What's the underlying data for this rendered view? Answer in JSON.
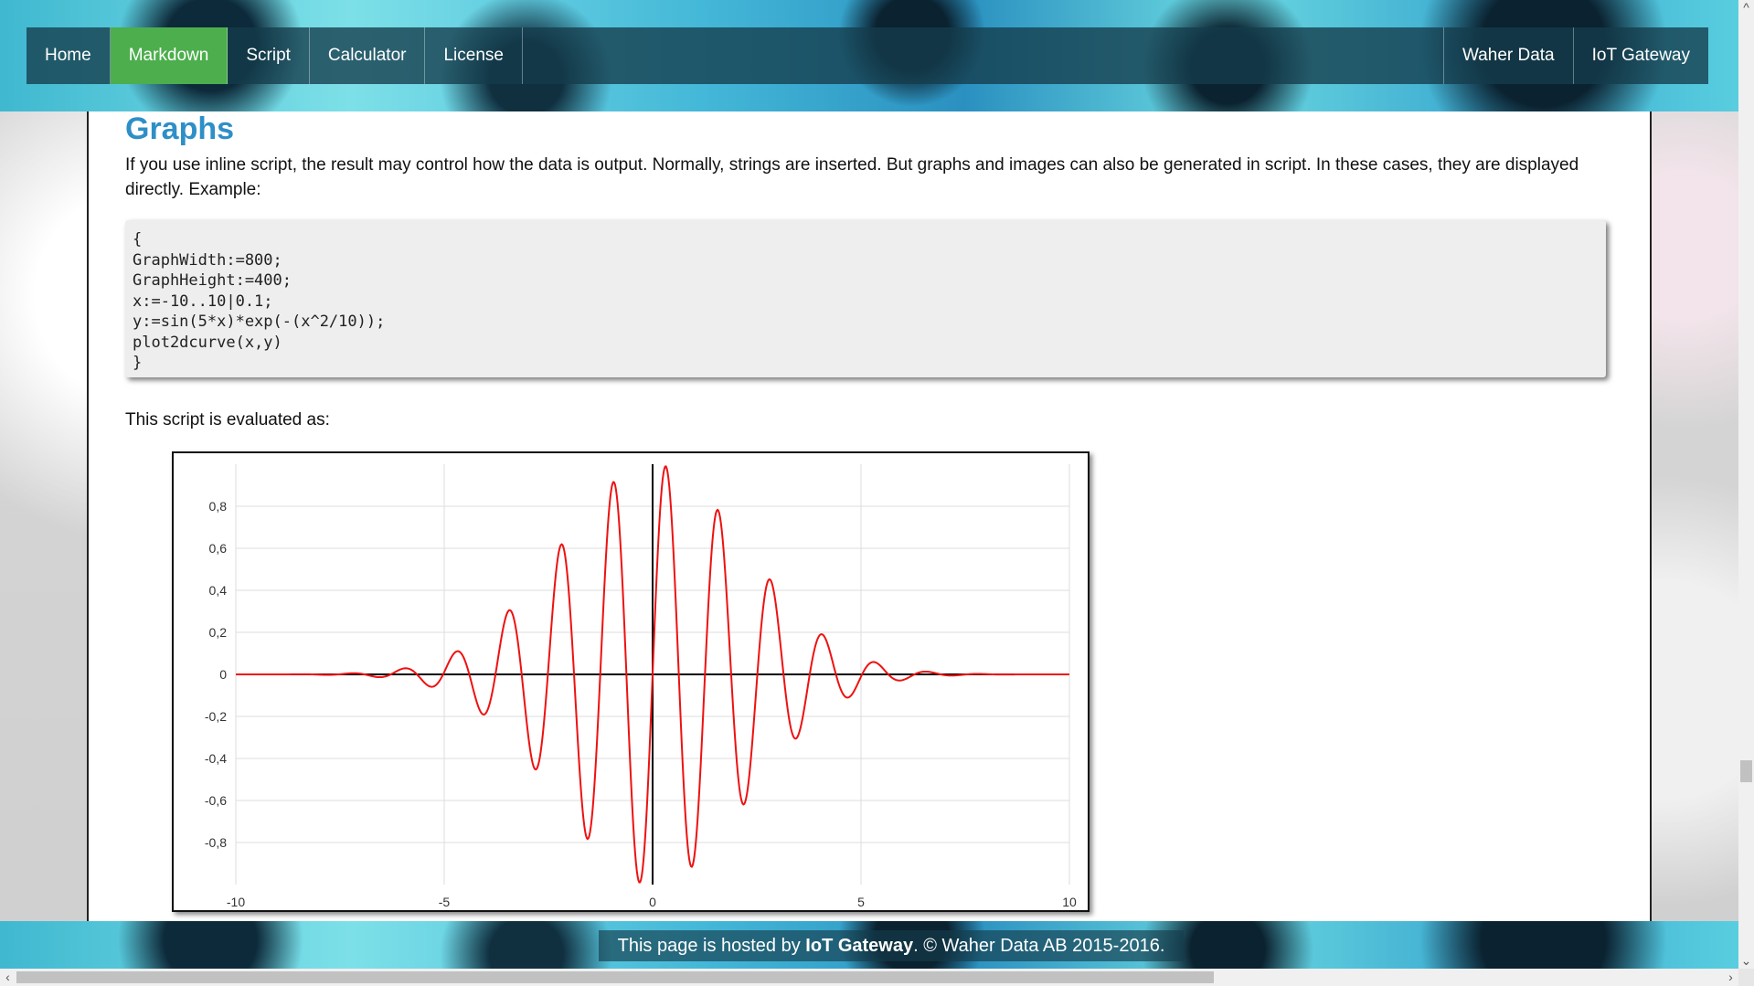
{
  "nav": {
    "left": [
      "Home",
      "Markdown",
      "Script",
      "Calculator",
      "License"
    ],
    "right": [
      "Waher Data",
      "IoT Gateway"
    ],
    "active": "Markdown"
  },
  "content": {
    "title": "Graphs",
    "intro": "If you use inline script, the result may control how the data is output. Normally, strings are inserted. But graphs and images can also be generated in script. In these cases, they are displayed directly. Example:",
    "code": "{\nGraphWidth:=800;\nGraphHeight:=400;\nx:=-10..10|0.1;\ny:=sin(5*x)*exp(-(x^2/10));\nplot2dcurve(x,y)\n}",
    "eval_text": "This script is evaluated as:"
  },
  "footer": {
    "prefix": "This page is hosted by ",
    "link1": "IoT Gateway",
    "middle": ". © ",
    "link2": "Waher Data AB",
    "suffix": " 2015-2016."
  },
  "chart_data": {
    "type": "line",
    "function": "sin(5*x)*exp(-(x^2/10))",
    "x_range": [
      -10,
      10
    ],
    "x_step": 0.1,
    "xlim": [
      -10,
      10
    ],
    "ylim": [
      -1,
      1
    ],
    "x_ticks": [
      "-10",
      "-5",
      "0",
      "5",
      "10"
    ],
    "y_ticks": [
      "0,8",
      "0,6",
      "0,4",
      "0,2",
      "0",
      "-0,2",
      "-0,4",
      "-0,6",
      "-0,8"
    ],
    "y_tick_values": [
      0.8,
      0.6,
      0.4,
      0.2,
      0,
      -0.2,
      -0.4,
      -0.6,
      -0.8
    ],
    "x_tick_values": [
      -10,
      -5,
      0,
      5,
      10
    ],
    "grid": true,
    "series": [
      {
        "color": "#ee1111"
      }
    ],
    "axis_color": "#000000"
  },
  "colors": {
    "active_nav": "#4cae4c",
    "title": "#2e8fc8"
  }
}
